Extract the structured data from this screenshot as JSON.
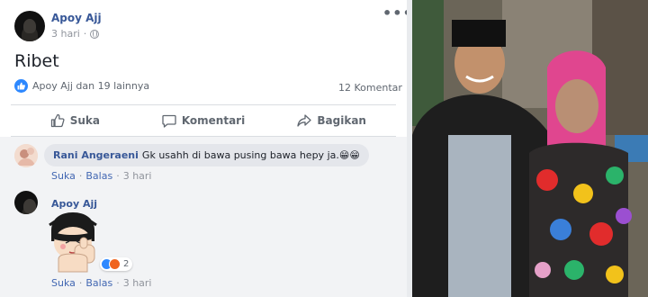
{
  "post": {
    "author": "Apoy Ajj",
    "time": "3 hari",
    "separator": "·",
    "text": "Ribet",
    "more": "•••",
    "reactions_summary": "Apoy Ajj dan 19 lainnya",
    "comment_count": "12 Komentar"
  },
  "actions": {
    "like": "Suka",
    "comment": "Komentari",
    "share": "Bagikan"
  },
  "comments": [
    {
      "author": "Rani Angeraeni",
      "text": "Gk usahh di bawa pusing bawa hepy ja.",
      "emoji": "😁😁",
      "like": "Suka",
      "reply": "Balas",
      "dot": "·",
      "time": "3 hari"
    },
    {
      "author": "Apoy Ajj",
      "sticker": "thumbs-up-girl-sticker",
      "reaction_count": "2",
      "like": "Suka",
      "reply": "Balas",
      "dot": "·",
      "time": "3 hari"
    }
  ],
  "colors": {
    "link_blue": "#385898",
    "like_blue": "#2d88ff",
    "angry_orange": "#f0641e"
  }
}
